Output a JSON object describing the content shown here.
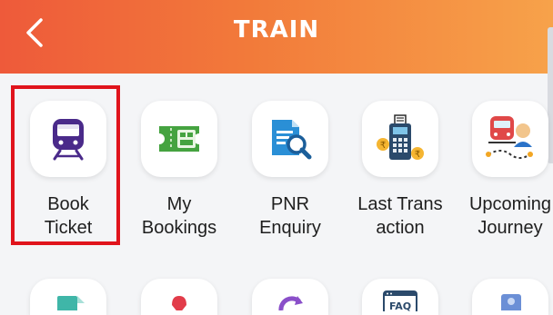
{
  "header": {
    "title": "TRAIN",
    "back_icon": "chevron-left-icon",
    "gradient": [
      "#ee5a3a",
      "#f7a24a"
    ]
  },
  "tiles": [
    {
      "icon": "train-icon",
      "line1": "Book",
      "line2": "Ticket",
      "selected": true
    },
    {
      "icon": "ticket-icon",
      "line1": "My",
      "line2": "Bookings"
    },
    {
      "icon": "document-search-icon",
      "line1": "PNR",
      "line2": "Enquiry"
    },
    {
      "icon": "pos-terminal-icon",
      "line1": "Last Trans",
      "line2": "action"
    },
    {
      "icon": "train-journey-icon",
      "line1": "Upcoming",
      "line2": "Journey"
    }
  ],
  "row2_icons": [
    "schedule-icon",
    "location-icon",
    "refresh-icon",
    "faq-icon",
    "profile-icon"
  ],
  "faq_text": "FAQ",
  "accent": "#e0141c"
}
